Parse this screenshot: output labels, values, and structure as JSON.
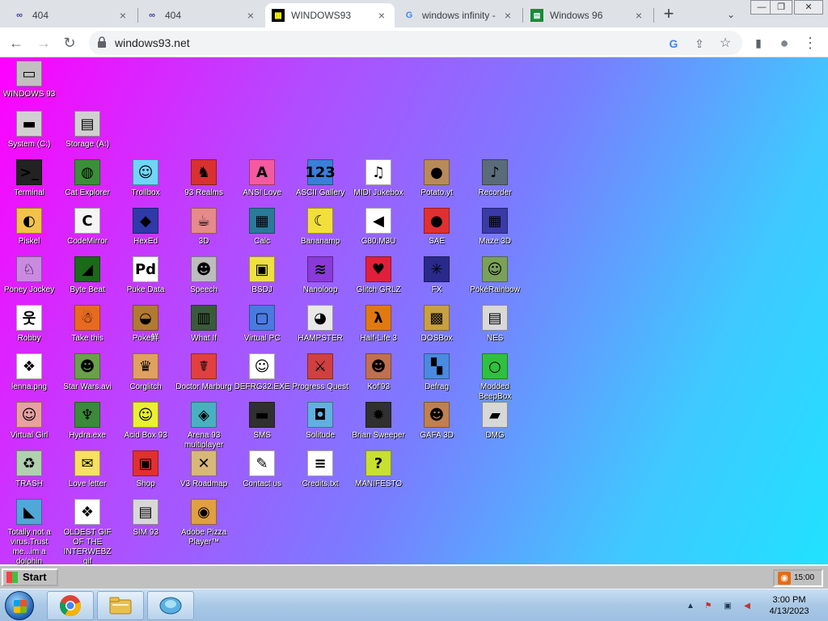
{
  "browser": {
    "tabs": [
      {
        "title": "404",
        "favicon": "glasses-favicon",
        "close": "×"
      },
      {
        "title": "404",
        "favicon": "glasses-favicon",
        "close": "×"
      },
      {
        "title": "WINDOWS93",
        "favicon": "windows93-favicon",
        "close": "×"
      },
      {
        "title": "windows infinity -",
        "favicon": "google-favicon",
        "close": "×"
      },
      {
        "title": "Windows 96",
        "favicon": "windows96-favicon",
        "close": "×"
      }
    ],
    "new_tab": "+",
    "tab_search": "⌄",
    "window_controls": {
      "minimize": "—",
      "restore": "❐",
      "close": "✕"
    },
    "nav": {
      "back": "←",
      "forward": "→",
      "reload": "↻"
    },
    "url": "windows93.net",
    "omnibox_icons": {
      "google": "G",
      "share": "⇪",
      "star": "☆"
    },
    "toolbar_icons": {
      "sidepanel": "▮",
      "profile": "●",
      "menu": "⋮"
    }
  },
  "desktop": {
    "top_icons": [
      {
        "label": "WINDOWS 93",
        "icon": "computer-icon",
        "color": "#c0c0c0"
      },
      {
        "label": "System (C:)",
        "icon": "drive-icon",
        "color": "#d0d0d0"
      },
      {
        "label": "Storage (A:)",
        "icon": "floppy-drive-icon",
        "color": "#d0d0d0"
      }
    ],
    "icons": [
      {
        "label": "Terminal",
        "icon": "terminal-icon",
        "color": "#222222"
      },
      {
        "label": "Cat Explorer",
        "icon": "cat-globe-icon",
        "color": "#3b8e3a"
      },
      {
        "label": "Trollbox",
        "icon": "chat-bubble-icon",
        "color": "#6fd6f7"
      },
      {
        "label": "93 Realms",
        "icon": "dragon-icon",
        "color": "#d93030"
      },
      {
        "label": "ANSI Love",
        "icon": "ansi-letter-icon",
        "color": "#f55aa0"
      },
      {
        "label": "ASCII Gallery",
        "icon": "ascii-numbers-icon",
        "color": "#3a7fd8"
      },
      {
        "label": "MIDI Jukebox",
        "icon": "piano-icon",
        "color": "#ffffff"
      },
      {
        "label": "Potato.yt",
        "icon": "potato-icon",
        "color": "#b88a5a"
      },
      {
        "label": "Recorder",
        "icon": "microphone-icon",
        "color": "#5a6b7a"
      },
      {
        "label": "Piskel",
        "icon": "palette-icon",
        "color": "#f2c24a"
      },
      {
        "label": "CodeMirror",
        "icon": "codemirror-icon",
        "color": "#f4f4f4"
      },
      {
        "label": "HexEd",
        "icon": "cube-icon",
        "color": "#2f3aa8"
      },
      {
        "label": "3D",
        "icon": "teapot-icon",
        "color": "#e68a8a"
      },
      {
        "label": "Calc",
        "icon": "calculator-icon",
        "color": "#2a7a9a"
      },
      {
        "label": "Bananamp",
        "icon": "banana-icon",
        "color": "#f3df3c"
      },
      {
        "label": "G80.M3U",
        "icon": "speaker-file-icon",
        "color": "#ffffff"
      },
      {
        "label": "SAE",
        "icon": "amiga-ball-icon",
        "color": "#e03030"
      },
      {
        "label": "Maze 3D",
        "icon": "maze-icon",
        "color": "#3a3aa8"
      },
      {
        "label": "Poney Jockey",
        "icon": "pony-icon",
        "color": "#c98ae0"
      },
      {
        "label": "Byte Beat",
        "icon": "bytebeat-icon",
        "color": "#1a6a1a"
      },
      {
        "label": "Puke Data",
        "icon": "puke-data-icon",
        "color": "#ffffff"
      },
      {
        "label": "Speech",
        "icon": "face-icon",
        "color": "#bdbdbd"
      },
      {
        "label": "BSDJ",
        "icon": "gameboy-icon",
        "color": "#f0e040"
      },
      {
        "label": "Nanoloop",
        "icon": "nanoloop-icon",
        "color": "#8a3ad8"
      },
      {
        "label": "Glitch GRLZ",
        "icon": "lips-icon",
        "color": "#e0203a"
      },
      {
        "label": "FX",
        "icon": "atom-icon",
        "color": "#2a2a8a"
      },
      {
        "label": "PokéRainbow",
        "icon": "pokemon-trainers-icon",
        "color": "#7aa05a"
      },
      {
        "label": "Robby",
        "icon": "stickman-icon",
        "color": "#ffffff"
      },
      {
        "label": "Take this",
        "icon": "wizard-icon",
        "color": "#e86a20"
      },
      {
        "label": "Poke鮮",
        "icon": "poke-bag-icon",
        "color": "#b07a30"
      },
      {
        "label": "What If",
        "icon": "matrix-icon",
        "color": "#3a5a3a"
      },
      {
        "label": "Virtual PC",
        "icon": "window-app-icon",
        "color": "#4a7ae0"
      },
      {
        "label": "HAMPSTER",
        "icon": "owl-icon",
        "color": "#e8e8e8"
      },
      {
        "label": "Half-Life 3",
        "icon": "lambda-icon",
        "color": "#e07a10"
      },
      {
        "label": "DOSBox",
        "icon": "dosbox-icon",
        "color": "#c8a040"
      },
      {
        "label": "NES",
        "icon": "nes-console-icon",
        "color": "#d8d8d8"
      },
      {
        "label": "lenna.png",
        "icon": "image-file-icon",
        "color": "#ffffff"
      },
      {
        "label": "Star Wars.avi",
        "icon": "yoda-icon",
        "color": "#6aa04a"
      },
      {
        "label": "Corglitch",
        "icon": "corgi-icon",
        "color": "#e0a060"
      },
      {
        "label": "Doctor Marburg",
        "icon": "doctor-icon",
        "color": "#e04040"
      },
      {
        "label": "DEFRG32.EXE",
        "icon": "monitor-face-icon",
        "color": "#ffffff"
      },
      {
        "label": "Progress Quest",
        "icon": "crossed-swords-icon",
        "color": "#d04040"
      },
      {
        "label": "Kof'93",
        "icon": "fighter-icon",
        "color": "#c07050"
      },
      {
        "label": "Defrag",
        "icon": "defrag-icon",
        "color": "#4a8ae0"
      },
      {
        "label": "Modded BeepBox",
        "icon": "ring-icon",
        "color": "#30c040"
      },
      {
        "label": "Virtual Girl",
        "icon": "girl-face-icon",
        "color": "#e8a0a0"
      },
      {
        "label": "Hydra.exe",
        "icon": "hydra-icon",
        "color": "#3a8a3a"
      },
      {
        "label": "Acid Box 93",
        "icon": "smiley-icon",
        "color": "#e8f030"
      },
      {
        "label": "Arena 93 multiplayer",
        "icon": "isometric-cube-icon",
        "color": "#4ab0c0"
      },
      {
        "label": "SMS",
        "icon": "sms-console-icon",
        "color": "#303030"
      },
      {
        "label": "Solitude",
        "icon": "bottle-icon",
        "color": "#60b0e0"
      },
      {
        "label": "Brian Sweeper",
        "icon": "mine-icon",
        "color": "#303030"
      },
      {
        "label": "GAFA 3D",
        "icon": "doomguy-icon",
        "color": "#c08050"
      },
      {
        "label": "DMG",
        "icon": "dmg-drive-icon",
        "color": "#d8d8d8"
      },
      {
        "label": "TRASH",
        "icon": "trash-icon",
        "color": "#b0d0b0"
      },
      {
        "label": "Love letter",
        "icon": "envelope-icon",
        "color": "#f8e060"
      },
      {
        "label": "Shop",
        "icon": "gift-icon",
        "color": "#e03030"
      },
      {
        "label": "V3 Roadmap",
        "icon": "map-icon",
        "color": "#d8b878"
      },
      {
        "label": "Contact us",
        "icon": "contact-pen-icon",
        "color": "#ffffff"
      },
      {
        "label": "Credits.txt",
        "icon": "text-file-icon",
        "color": "#ffffff"
      },
      {
        "label": "MANIFESTO",
        "icon": "question-mark-icon",
        "color": "#c8e030"
      },
      {
        "label": "Totally not a virus.Trust me...im a dolphin",
        "icon": "dolphin-icon",
        "color": "#50a8d8"
      },
      {
        "label": "OLDEST GIF OF THE INTERWEBZ gif",
        "icon": "gif-file-icon",
        "color": "#ffffff"
      },
      {
        "label": "SIM 93",
        "icon": "sim-book-icon",
        "color": "#d8d8d8"
      },
      {
        "label": "Adobe Pizza Player™",
        "icon": "pizza-icon",
        "color": "#e0a040"
      }
    ]
  },
  "w93_taskbar": {
    "start_label": "Start",
    "clock": "15:00"
  },
  "win7_taskbar": {
    "time": "3:00 PM",
    "date": "4/13/2023",
    "tray_icons": [
      "show-hidden-icon",
      "action-center-icon",
      "network-icon",
      "volume-muted-icon"
    ]
  }
}
